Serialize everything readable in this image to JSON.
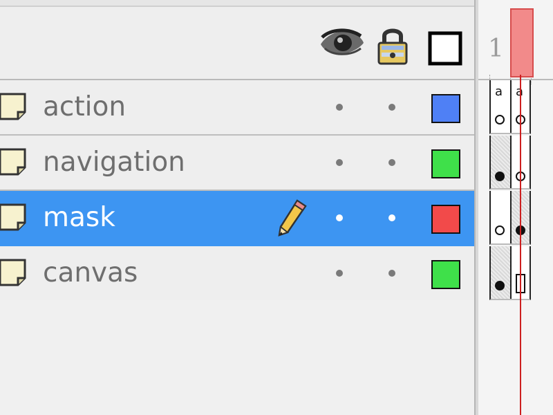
{
  "layer_panel": {
    "column_headers": {
      "visibility_icon": "eye-icon",
      "lock_icon": "padlock-icon",
      "outline_icon": "outline-square-icon"
    },
    "layers": [
      {
        "name": "action",
        "selected": false,
        "color": "#4f80f5",
        "icon": "folded-page-icon",
        "visible_dot": "•",
        "lock_dot": "•"
      },
      {
        "name": "navigation",
        "selected": false,
        "color": "#3fe04a",
        "icon": "folded-page-icon",
        "visible_dot": "•",
        "lock_dot": "•"
      },
      {
        "name": "mask",
        "selected": true,
        "color": "#f24a4a",
        "icon": "folded-page-icon",
        "edit_icon": "pencil-icon",
        "visible_dot": "•",
        "lock_dot": "•"
      },
      {
        "name": "canvas",
        "selected": false,
        "color": "#3fe04a",
        "icon": "folded-page-icon",
        "visible_dot": "•",
        "lock_dot": "•"
      }
    ]
  },
  "timeline": {
    "frame_number": "1",
    "playhead_color": "#f28a8a",
    "playhead_line_color": "#cc1f1f",
    "action_marker": "a"
  },
  "colors": {
    "selection": "#3d95f2",
    "panel_bg": "#eeeeee",
    "text": "#6e6e6e"
  }
}
